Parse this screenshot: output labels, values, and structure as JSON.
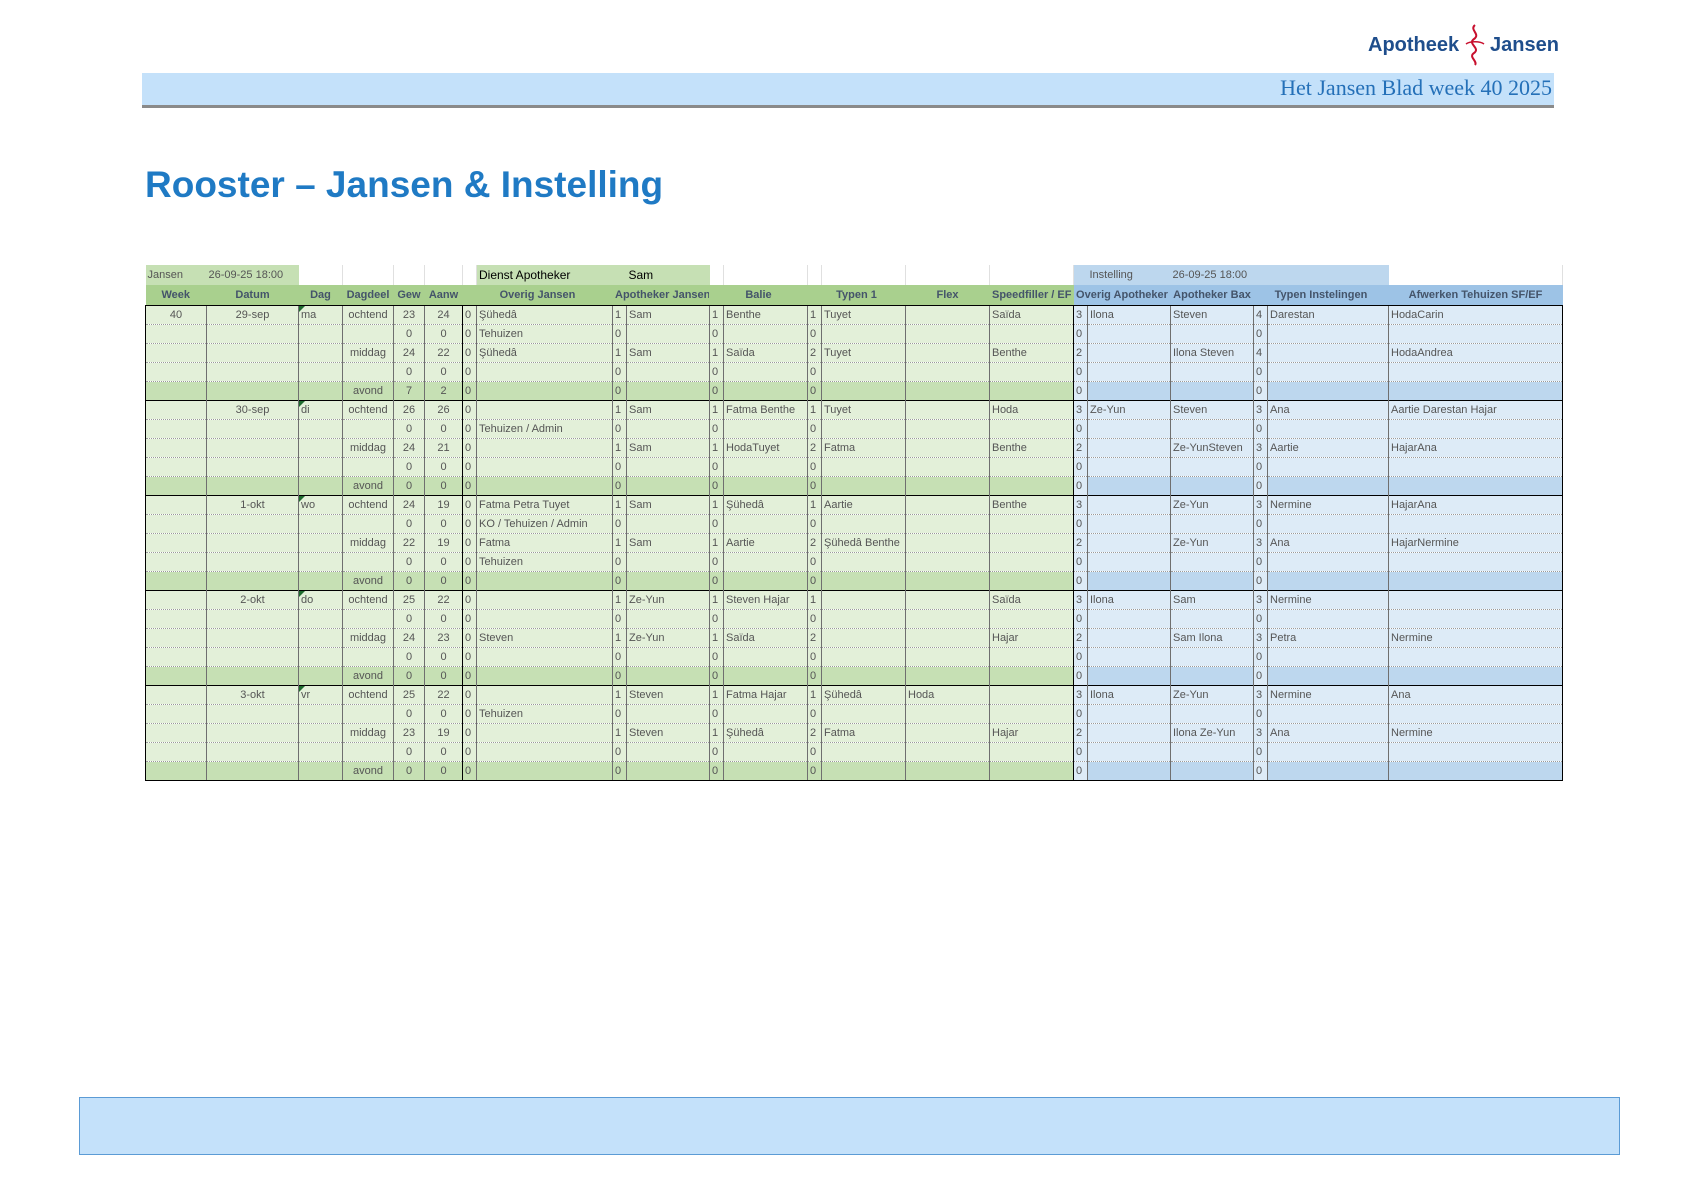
{
  "header": {
    "logo_left": "Apotheek",
    "logo_right": "Jansen",
    "title": "Het Jansen Blad week 40  2025"
  },
  "page_title": "Rooster – Jansen & Instelling",
  "info": {
    "jansen_label": "Jansen",
    "jansen_date": "26-09-25 18:00",
    "dienst_label": "Dienst Apotheker",
    "dienst_value": "Sam",
    "instelling_label": "Instelling",
    "instelling_date": "26-09-25 18:00"
  },
  "columns": [
    "Week",
    "Datum",
    "Dag",
    "Dagdeel",
    "Gew",
    "Aanw",
    "Overig Jansen",
    "Apotheker Jansen",
    "Balie",
    "Typen 1",
    "Flex",
    "Speedfiller / EF",
    "Overig Apotheker",
    "Apotheker Bax",
    "Typen Instelingen",
    "Afwerken Tehuizen SF/EF"
  ],
  "rows": [
    [
      "40",
      "29-sep",
      "ma",
      "ochtend",
      "23",
      "24",
      "0",
      "Şühedâ",
      "1",
      "Sam",
      "1",
      "Benthe",
      "1",
      "Tuyet",
      "",
      "Saïda",
      "3",
      "Ilona",
      "Steven",
      "4",
      "Darestan",
      "HodaCarin"
    ],
    [
      "",
      "",
      "",
      "",
      "0",
      "0",
      "0",
      "Tehuizen",
      "0",
      "",
      "0",
      "",
      "0",
      "",
      "",
      "",
      "0",
      "",
      "",
      "0",
      "",
      ""
    ],
    [
      "",
      "",
      "",
      "middag",
      "24",
      "22",
      "0",
      "Şühedâ",
      "1",
      "Sam",
      "1",
      "Saïda",
      "2",
      "Tuyet",
      "",
      "Benthe",
      "2",
      "",
      "Ilona Steven",
      "4",
      "",
      "HodaAndrea"
    ],
    [
      "",
      "",
      "",
      "",
      "0",
      "0",
      "0",
      "",
      "0",
      "",
      "0",
      "",
      "0",
      "",
      "",
      "",
      "0",
      "",
      "",
      "0",
      "",
      ""
    ],
    [
      "",
      "",
      "",
      "avond",
      "7",
      "2",
      "0",
      "",
      "0",
      "",
      "0",
      "",
      "0",
      "",
      "",
      "",
      "0",
      "",
      "",
      "0",
      "",
      ""
    ],
    [
      "",
      "30-sep",
      "di",
      "ochtend",
      "26",
      "26",
      "0",
      "",
      "1",
      "Sam",
      "1",
      "Fatma Benthe",
      "1",
      "Tuyet",
      "",
      "Hoda",
      "3",
      "Ze-Yun",
      "Steven",
      "3",
      "Ana",
      "Aartie Darestan  Hajar"
    ],
    [
      "",
      "",
      "",
      "",
      "0",
      "0",
      "0",
      "Tehuizen / Admin",
      "0",
      "",
      "0",
      "",
      "0",
      "",
      "",
      "",
      "0",
      "",
      "",
      "0",
      "",
      ""
    ],
    [
      "",
      "",
      "",
      "middag",
      "24",
      "21",
      "0",
      "",
      "1",
      "Sam",
      "1",
      "HodaTuyet",
      "2",
      "Fatma",
      "",
      "Benthe",
      "2",
      "",
      "Ze-YunSteven",
      "3",
      "Aartie",
      "HajarAna"
    ],
    [
      "",
      "",
      "",
      "",
      "0",
      "0",
      "0",
      "",
      "0",
      "",
      "0",
      "",
      "0",
      "",
      "",
      "",
      "0",
      "",
      "",
      "0",
      "",
      ""
    ],
    [
      "",
      "",
      "",
      "avond",
      "0",
      "0",
      "0",
      "",
      "0",
      "",
      "0",
      "",
      "0",
      "",
      "",
      "",
      "0",
      "",
      "",
      "0",
      "",
      ""
    ],
    [
      "",
      "1-okt",
      "wo",
      "ochtend",
      "24",
      "19",
      "0",
      "Fatma Petra Tuyet",
      "1",
      "Sam",
      "1",
      "Şühedâ",
      "1",
      "Aartie",
      "",
      "Benthe",
      "3",
      "",
      "Ze-Yun",
      "3",
      "Nermine",
      "HajarAna"
    ],
    [
      "",
      "",
      "",
      "",
      "0",
      "0",
      "0",
      "KO / Tehuizen / Admin",
      "0",
      "",
      "0",
      "",
      "0",
      "",
      "",
      "",
      "0",
      "",
      "",
      "0",
      "",
      ""
    ],
    [
      "",
      "",
      "",
      "middag",
      "22",
      "19",
      "0",
      "Fatma",
      "1",
      "Sam",
      "1",
      "Aartie",
      "2",
      "Şühedâ Benthe",
      "",
      "",
      "2",
      "",
      "Ze-Yun",
      "3",
      "Ana",
      "HajarNermine"
    ],
    [
      "",
      "",
      "",
      "",
      "0",
      "0",
      "0",
      "Tehuizen",
      "0",
      "",
      "0",
      "",
      "0",
      "",
      "",
      "",
      "0",
      "",
      "",
      "0",
      "",
      ""
    ],
    [
      "",
      "",
      "",
      "avond",
      "0",
      "0",
      "0",
      "",
      "0",
      "",
      "0",
      "",
      "0",
      "",
      "",
      "",
      "0",
      "",
      "",
      "0",
      "",
      ""
    ],
    [
      "",
      "2-okt",
      "do",
      "ochtend",
      "25",
      "22",
      "0",
      "",
      "1",
      "Ze-Yun",
      "1",
      "Steven Hajar",
      "1",
      "",
      "",
      "Saïda",
      "3",
      "Ilona",
      "Sam",
      "3",
      "Nermine",
      ""
    ],
    [
      "",
      "",
      "",
      "",
      "0",
      "0",
      "0",
      "",
      "0",
      "",
      "0",
      "",
      "0",
      "",
      "",
      "",
      "0",
      "",
      "",
      "0",
      "",
      ""
    ],
    [
      "",
      "",
      "",
      "middag",
      "24",
      "23",
      "0",
      "Steven",
      "1",
      "Ze-Yun",
      "1",
      "Saïda",
      "2",
      "",
      "",
      "Hajar",
      "2",
      "",
      "Sam Ilona",
      "3",
      "Petra",
      "Nermine"
    ],
    [
      "",
      "",
      "",
      "",
      "0",
      "0",
      "0",
      "",
      "0",
      "",
      "0",
      "",
      "0",
      "",
      "",
      "",
      "0",
      "",
      "",
      "0",
      "",
      ""
    ],
    [
      "",
      "",
      "",
      "avond",
      "0",
      "0",
      "0",
      "",
      "0",
      "",
      "0",
      "",
      "0",
      "",
      "",
      "",
      "0",
      "",
      "",
      "0",
      "",
      ""
    ],
    [
      "",
      "3-okt",
      "vr",
      "ochtend",
      "25",
      "22",
      "0",
      "",
      "1",
      "Steven",
      "1",
      "Fatma Hajar",
      "1",
      "Şühedâ",
      "Hoda",
      "",
      "3",
      "Ilona",
      "Ze-Yun",
      "3",
      "Nermine",
      "Ana"
    ],
    [
      "",
      "",
      "",
      "",
      "0",
      "0",
      "0",
      "Tehuizen",
      "0",
      "",
      "0",
      "",
      "0",
      "",
      "",
      "",
      "0",
      "",
      "",
      "0",
      "",
      ""
    ],
    [
      "",
      "",
      "",
      "middag",
      "23",
      "19",
      "0",
      "",
      "1",
      "Steven",
      "1",
      "Şühedâ",
      "2",
      "Fatma",
      "",
      "Hajar",
      "2",
      "",
      "Ilona Ze-Yun",
      "3",
      "Ana",
      "Nermine"
    ],
    [
      "",
      "",
      "",
      "",
      "0",
      "0",
      "0",
      "",
      "0",
      "",
      "0",
      "",
      "0",
      "",
      "",
      "",
      "0",
      "",
      "",
      "0",
      "",
      ""
    ],
    [
      "",
      "",
      "",
      "avond",
      "0",
      "0",
      "0",
      "",
      "0",
      "",
      "0",
      "",
      "0",
      "",
      "",
      "",
      "0",
      "",
      "",
      "0",
      "",
      ""
    ]
  ]
}
